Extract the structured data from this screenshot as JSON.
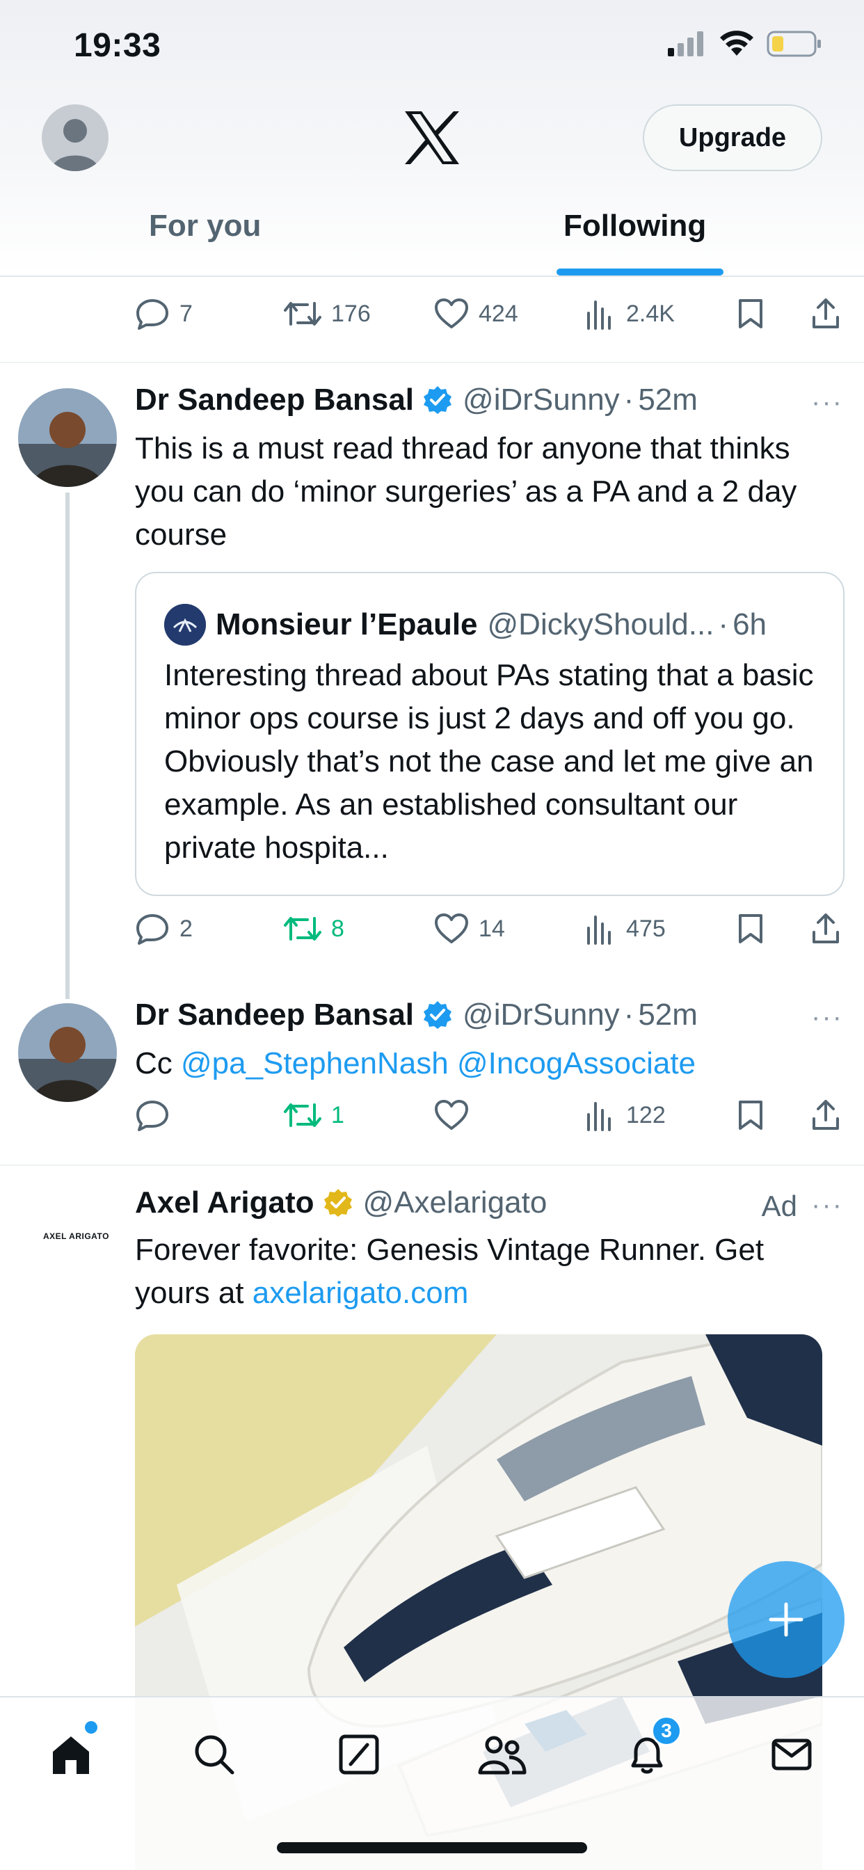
{
  "status_bar": {
    "time": "19:33"
  },
  "header": {
    "upgrade_label": "Upgrade",
    "tabs": [
      {
        "label": "For you",
        "active": false
      },
      {
        "label": "Following",
        "active": true
      }
    ],
    "accent_color": "#1d9bf0"
  },
  "top_actions": {
    "replies": "7",
    "reposts": "176",
    "likes": "424",
    "views": "2.4K"
  },
  "tweets": [
    {
      "name": "Dr Sandeep Bansal",
      "handle": "@iDrSunny",
      "time": "52m",
      "verified": "blue",
      "text": "This is a must read thread for anyone that thinks you can do ‘minor surgeries’ as a PA and a 2 day course",
      "quote": {
        "name": "Monsieur l’Epaule",
        "handle": "@DickyShould...",
        "time": "6h",
        "text": "Interesting thread about PAs stating that a basic minor ops course is just 2 days and off you go. Obviously that’s not the case and let me give an example. As an established consultant our private hospita..."
      },
      "actions": {
        "replies": "2",
        "reposts": "8",
        "likes": "14",
        "views": "475"
      }
    },
    {
      "name": "Dr Sandeep Bansal",
      "handle": "@iDrSunny",
      "time": "52m",
      "verified": "blue",
      "text_prefix": "Cc ",
      "mentions": [
        "@pa_StephenNash",
        "@IncogAssociate"
      ],
      "actions": {
        "replies": "",
        "reposts": "1",
        "likes": "",
        "views": "122"
      }
    }
  ],
  "ad": {
    "name": "Axel Arigato",
    "handle": "@Axelarigato",
    "label": "Ad",
    "logo_text": "AXEL ARIGATO",
    "verified": "gold",
    "text": "Forever favorite: Genesis Vintage Runner. Get yours at ",
    "link": "axelarigato.com"
  },
  "bottom_nav": {
    "items": [
      "home",
      "search",
      "grok",
      "communities",
      "notifications",
      "messages"
    ],
    "notifications_badge": "3"
  },
  "more_label": "···",
  "dot_sep": "·"
}
